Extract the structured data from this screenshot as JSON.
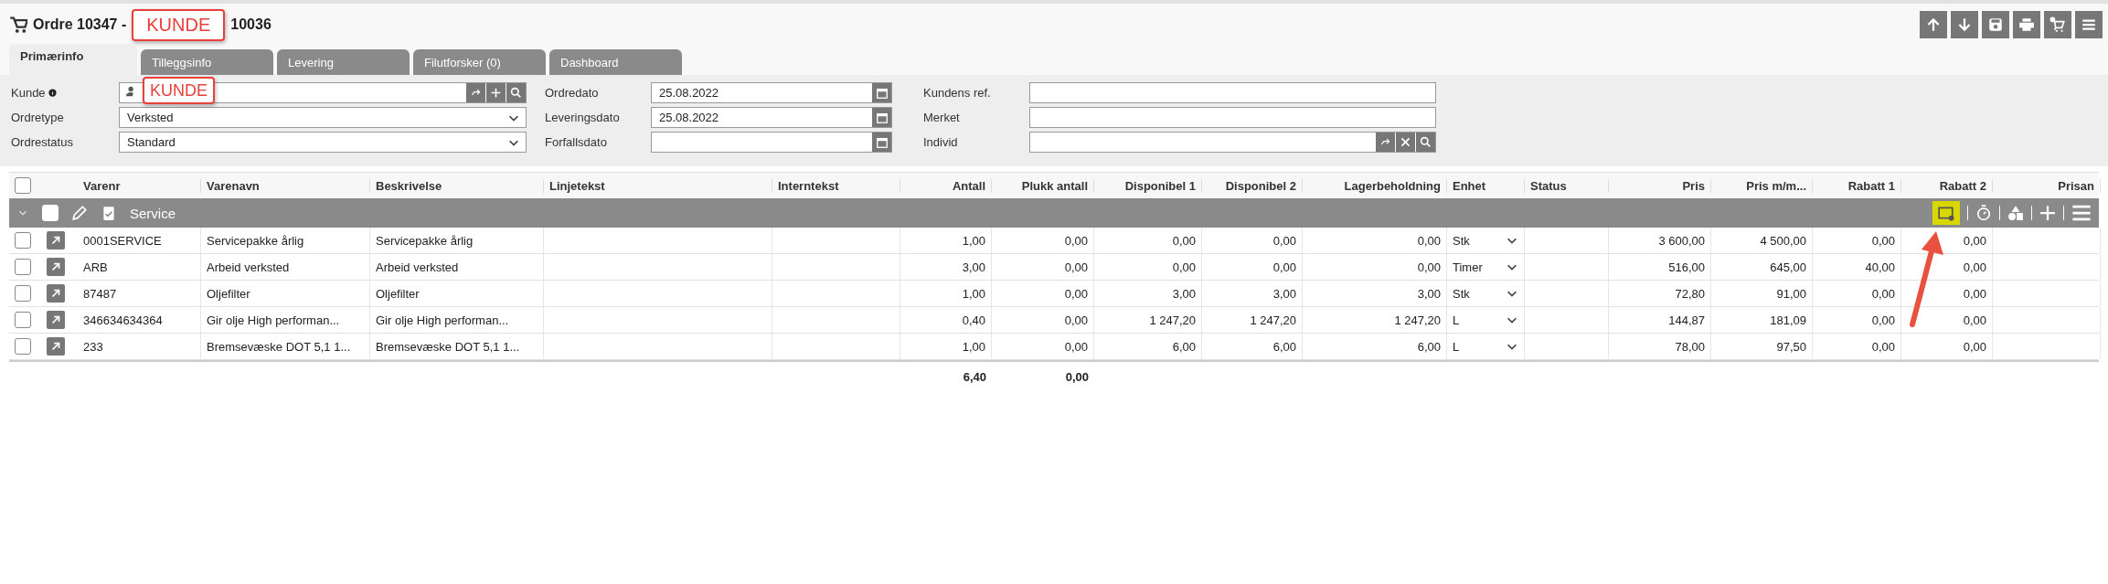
{
  "title": {
    "before": "Ordre 10347 -",
    "after": "10036",
    "annotation": "KUNDE"
  },
  "tabs": [
    {
      "label": "Primærinfo",
      "selected": true
    },
    {
      "label": "Tilleggsinfo",
      "selected": false
    },
    {
      "label": "Levering",
      "selected": false
    },
    {
      "label": "Filutforsker (0)",
      "selected": false
    },
    {
      "label": "Dashboard",
      "selected": false
    }
  ],
  "form": {
    "left": [
      {
        "kind": "lookup",
        "label": "Kunde",
        "annotation": "KUNDE"
      },
      {
        "kind": "select",
        "label": "Ordretype",
        "value": "Verksted"
      },
      {
        "kind": "select",
        "label": "Ordrestatus",
        "value": "Standard"
      }
    ],
    "middle": [
      {
        "kind": "date",
        "label": "Ordredato",
        "value": "25.08.2022"
      },
      {
        "kind": "date",
        "label": "Leveringsdato",
        "value": "25.08.2022"
      },
      {
        "kind": "date",
        "label": "Forfallsdato"
      }
    ],
    "right": [
      {
        "kind": "text",
        "label": "Kundens ref."
      },
      {
        "kind": "text",
        "label": "Merket"
      },
      {
        "kind": "search",
        "label": "Individ"
      }
    ]
  },
  "table": {
    "columns": [
      {
        "label": "Varenr",
        "kind": "text"
      },
      {
        "label": "Varenavn",
        "kind": "text"
      },
      {
        "label": "Beskrivelse",
        "kind": "text"
      },
      {
        "label": "Linjetekst",
        "kind": "text"
      },
      {
        "label": "Interntekst",
        "kind": "text"
      },
      {
        "label": "Antall",
        "kind": "number",
        "total": "6,40"
      },
      {
        "label": "Plukk antall",
        "kind": "number",
        "total": "0,00"
      },
      {
        "label": "Disponibel 1",
        "kind": "number"
      },
      {
        "label": "Disponibel 2",
        "kind": "number"
      },
      {
        "label": "Lagerbeholdning",
        "kind": "number"
      },
      {
        "label": "Enhet",
        "kind": "select"
      },
      {
        "label": "Status",
        "kind": "text"
      },
      {
        "label": "Pris",
        "kind": "number"
      },
      {
        "label": "Pris m/m...",
        "kind": "number"
      },
      {
        "label": "Rabatt 1",
        "kind": "number"
      },
      {
        "label": "Rabatt 2",
        "kind": "number"
      },
      {
        "label": "Prisan",
        "kind": "number"
      }
    ],
    "header_checked": false,
    "group": {
      "label": "Service",
      "checked": false,
      "expanded": true
    },
    "rows": [
      {
        "checked": false,
        "varenr": "0001SERVICE",
        "varenavn": "Servicepakke årlig",
        "beskrivelse": "Servicepakke årlig",
        "antall": "1,00",
        "plukk_antall": "0,00",
        "disponibel_1": "0,00",
        "disponibel_2": "0,00",
        "lagerbeholdning": "0,00",
        "enhet": "Stk",
        "pris": "3 600,00",
        "pris_mm": "4 500,00",
        "rabatt_1": "0,00",
        "rabatt_2": "0,00"
      },
      {
        "checked": false,
        "varenr": "ARB",
        "varenavn": "Arbeid verksted",
        "beskrivelse": "Arbeid verksted",
        "antall": "3,00",
        "plukk_antall": "0,00",
        "disponibel_1": "0,00",
        "disponibel_2": "0,00",
        "lagerbeholdning": "0,00",
        "enhet": "Timer",
        "pris": "516,00",
        "pris_mm": "645,00",
        "rabatt_1": "40,00",
        "rabatt_2": "0,00"
      },
      {
        "checked": false,
        "varenr": "87487",
        "varenavn": "Oljefilter",
        "beskrivelse": "Oljefilter",
        "antall": "1,00",
        "plukk_antall": "0,00",
        "disponibel_1": "3,00",
        "disponibel_2": "3,00",
        "lagerbeholdning": "3,00",
        "enhet": "Stk",
        "pris": "72,80",
        "pris_mm": "91,00",
        "rabatt_1": "0,00",
        "rabatt_2": "0,00"
      },
      {
        "checked": false,
        "varenr": "346634634364",
        "varenavn": "Gir olje High performan...",
        "beskrivelse": "Gir olje High performan...",
        "antall": "0,40",
        "plukk_antall": "0,00",
        "disponibel_1": "1 247,20",
        "disponibel_2": "1 247,20",
        "lagerbeholdning": "1 247,20",
        "enhet": "L",
        "pris": "144,87",
        "pris_mm": "181,09",
        "rabatt_1": "0,00",
        "rabatt_2": "0,00"
      },
      {
        "checked": false,
        "varenr": "233",
        "varenavn": "Bremsevæske DOT 5,1 1...",
        "beskrivelse": "Bremsevæske DOT 5,1 1...",
        "antall": "1,00",
        "plukk_antall": "0,00",
        "disponibel_1": "6,00",
        "disponibel_2": "6,00",
        "lagerbeholdning": "6,00",
        "enhet": "L",
        "pris": "78,00",
        "pris_mm": "97,50",
        "rabatt_1": "0,00",
        "rabatt_2": "0,00"
      }
    ]
  }
}
